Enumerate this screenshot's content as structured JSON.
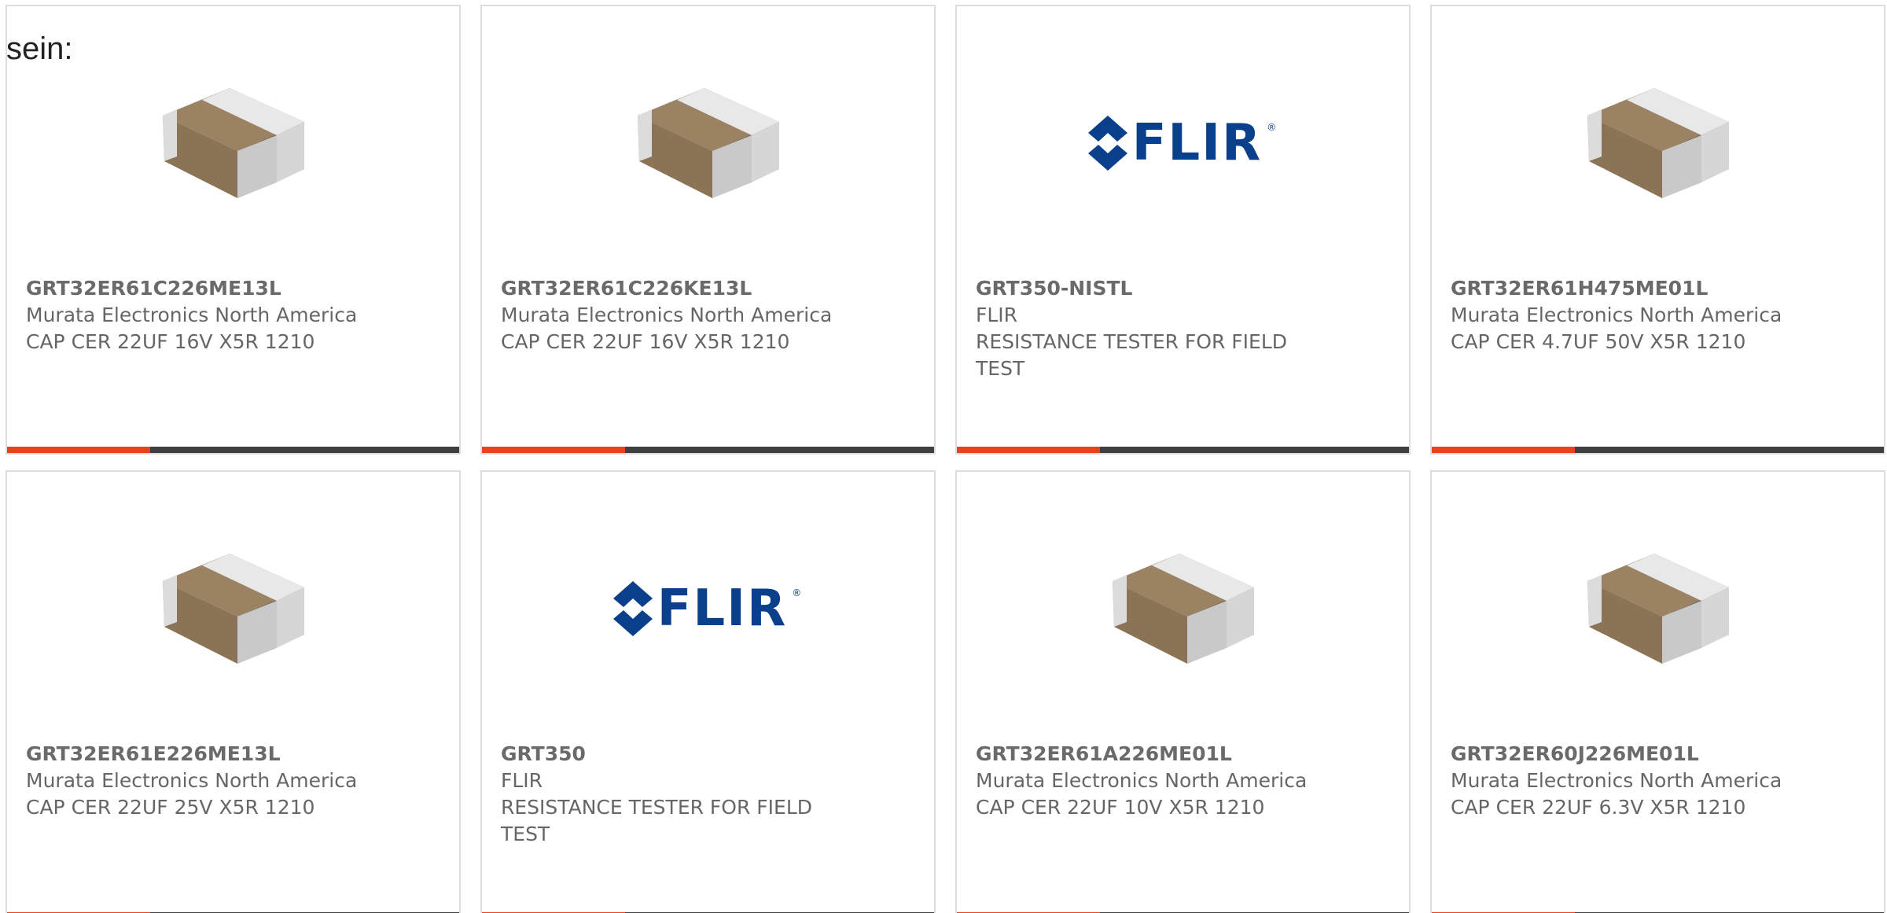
{
  "intro_text": "sein:",
  "colors": {
    "accent": "#e8411b",
    "bar": "#404040",
    "flir_blue": "#0a3f8c"
  },
  "products": [
    {
      "part": "GRT32ER61C226ME13L",
      "manufacturer": "Murata Electronics North America",
      "description": "CAP CER 22UF 16V X5R 1210",
      "image": "capacitor-chip"
    },
    {
      "part": "GRT32ER61C226KE13L",
      "manufacturer": "Murata Electronics North America",
      "description": "CAP CER 22UF 16V X5R 1210",
      "image": "capacitor-chip"
    },
    {
      "part": "GRT350-NISTL",
      "manufacturer": "FLIR",
      "description": "RESISTANCE TESTER FOR FIELD TEST",
      "image": "flir-logo",
      "logo_text": "FLIR"
    },
    {
      "part": "GRT32ER61H475ME01L",
      "manufacturer": "Murata Electronics North America",
      "description": "CAP CER 4.7UF 50V X5R 1210",
      "image": "capacitor-chip"
    },
    {
      "part": "GRT32ER61E226ME13L",
      "manufacturer": "Murata Electronics North America",
      "description": "CAP CER 22UF 25V X5R 1210",
      "image": "capacitor-chip"
    },
    {
      "part": "GRT350",
      "manufacturer": "FLIR",
      "description": "RESISTANCE TESTER FOR FIELD TEST",
      "image": "flir-logo",
      "logo_text": "FLIR"
    },
    {
      "part": "GRT32ER61A226ME01L",
      "manufacturer": "Murata Electronics North America",
      "description": "CAP CER 22UF 10V X5R 1210",
      "image": "capacitor-chip"
    },
    {
      "part": "GRT32ER60J226ME01L",
      "manufacturer": "Murata Electronics North America",
      "description": "CAP CER 22UF 6.3V X5R 1210",
      "image": "capacitor-chip"
    }
  ]
}
